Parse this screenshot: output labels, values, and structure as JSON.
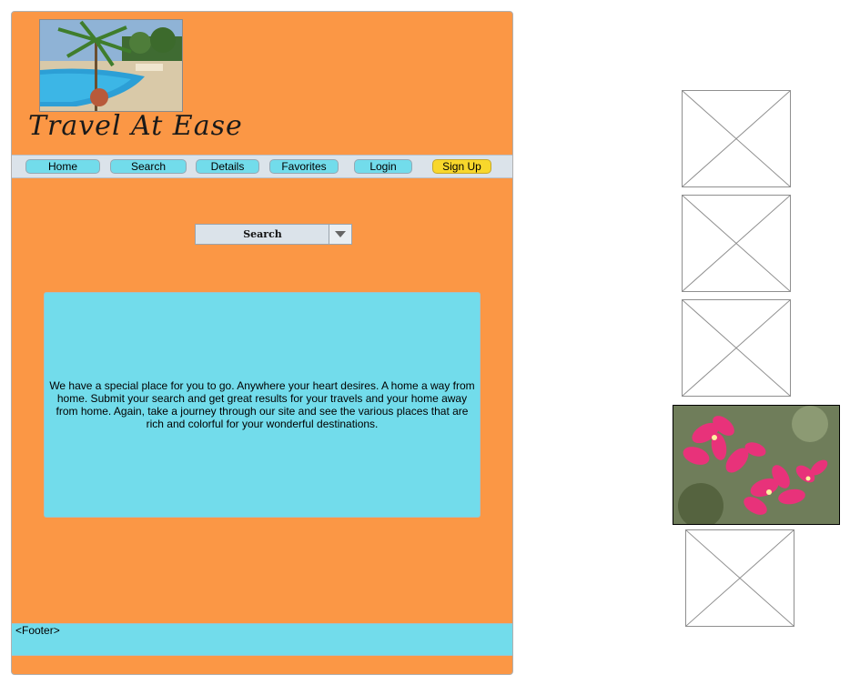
{
  "brand": {
    "title": "Travel At Ease",
    "hero_image": "pool-resort-photo"
  },
  "nav": {
    "items": [
      {
        "label": "Home"
      },
      {
        "label": "Search"
      },
      {
        "label": "Details"
      },
      {
        "label": "Favorites"
      },
      {
        "label": "Login"
      },
      {
        "label": "Sign Up"
      }
    ]
  },
  "search": {
    "selected": "Search"
  },
  "intro": {
    "text": "We have a special place for you to go.  Anywhere your heart desires.  A home a way from home.  Submit your search and get great results for your travels and your home away from home.  Again, take a journey through our site and see the various places that are rich and colorful for your wonderful destinations."
  },
  "footer": {
    "label": "<Footer>"
  },
  "side_images": {
    "placeholder_icon": "image-placeholder-icon",
    "photo": "pink-flower-photo"
  },
  "colors": {
    "page_bg": "#fb9745",
    "panel": "#72dceb",
    "nav_bar": "#dbe3ea",
    "signup": "#f8d72c"
  }
}
